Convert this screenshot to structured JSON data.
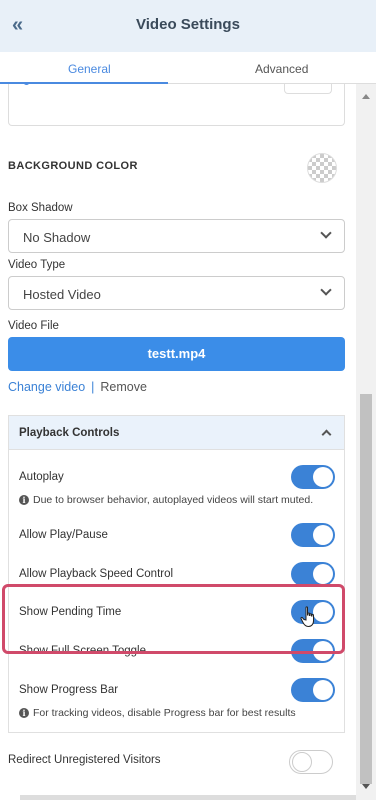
{
  "header": {
    "collapse_icon": "«",
    "title": "Video Settings"
  },
  "tabs": [
    {
      "label": "General"
    },
    {
      "label": "Advanced"
    }
  ],
  "background": {
    "label": "BACKGROUND COLOR"
  },
  "box_shadow": {
    "label": "Box Shadow",
    "value": "No Shadow"
  },
  "video_type": {
    "label": "Video Type",
    "value": "Hosted Video"
  },
  "video_file": {
    "label": "Video File",
    "filename": "testt.mp4",
    "change_label": "Change video",
    "separator": "|",
    "remove_label": "Remove"
  },
  "playback": {
    "title": "Playback Controls",
    "items": [
      {
        "label": "Autoplay",
        "on": true,
        "hint": "Due to browser behavior, autoplayed videos will start muted."
      },
      {
        "label": "Allow Play/Pause",
        "on": true
      },
      {
        "label": "Allow Playback Speed Control",
        "on": true
      },
      {
        "label": "Show Pending Time",
        "on": true
      },
      {
        "label": "Show Full Screen Toggle",
        "on": true
      },
      {
        "label": "Show Progress Bar",
        "on": true,
        "hint": "For tracking videos, disable Progress bar for best results"
      }
    ]
  },
  "redirect": {
    "label": "Redirect Unregistered Visitors",
    "on": false
  },
  "colors": {
    "accent": "#3b82d6",
    "button": "#3b8de8",
    "header_bg": "#e8f0f8",
    "highlight": "#d04a6a"
  }
}
